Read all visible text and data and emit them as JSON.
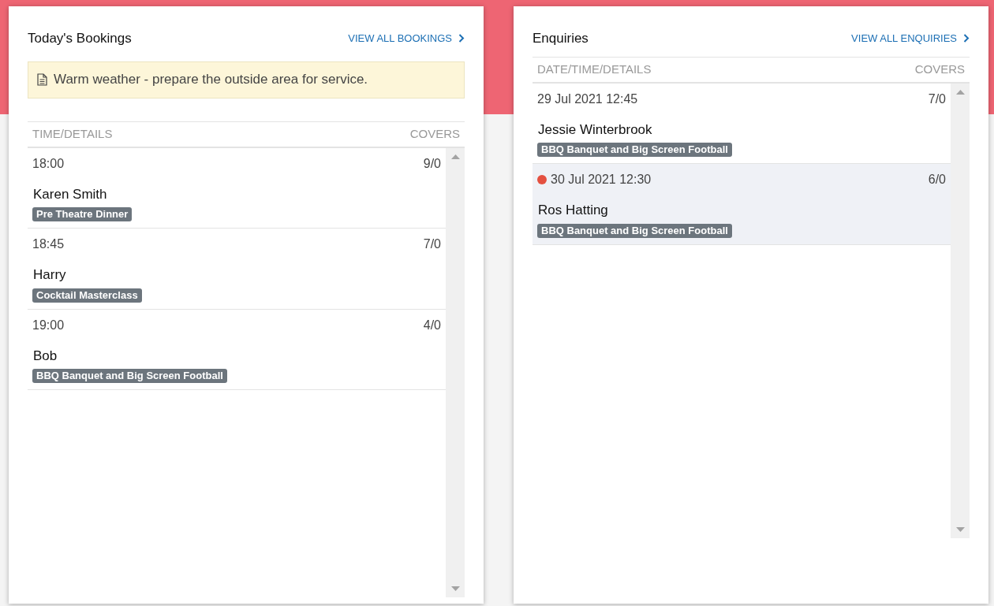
{
  "bookings": {
    "title": "Today's Bookings",
    "link": "VIEW ALL BOOKINGS",
    "note": "Warm weather - prepare the outside area for service.",
    "columns": [
      "TIME/DETAILS",
      "COVERS"
    ],
    "rows": [
      {
        "time": "18:00",
        "covers": "9/0",
        "name": "Karen Smith",
        "tag": "Pre Theatre Dinner"
      },
      {
        "time": "18:45",
        "covers": "7/0",
        "name": "Harry",
        "tag": "Cocktail Masterclass"
      },
      {
        "time": "19:00",
        "covers": "4/0",
        "name": "Bob",
        "tag": "BBQ Banquet and Big Screen Football"
      }
    ]
  },
  "enquiries": {
    "title": "Enquiries",
    "link": "VIEW ALL ENQUIRIES",
    "columns": [
      "DATE/TIME/DETAILS",
      "COVERS"
    ],
    "rows": [
      {
        "time": "29 Jul 2021 12:45",
        "covers": "7/0",
        "name": "Jessie Winterbrook",
        "tag": "BBQ Banquet and Big Screen Football",
        "selected": false,
        "flagged": false
      },
      {
        "time": "30 Jul 2021 12:30",
        "covers": "6/0",
        "name": "Ros Hatting",
        "tag": "BBQ Banquet and Big Screen Football",
        "selected": true,
        "flagged": true
      }
    ]
  }
}
